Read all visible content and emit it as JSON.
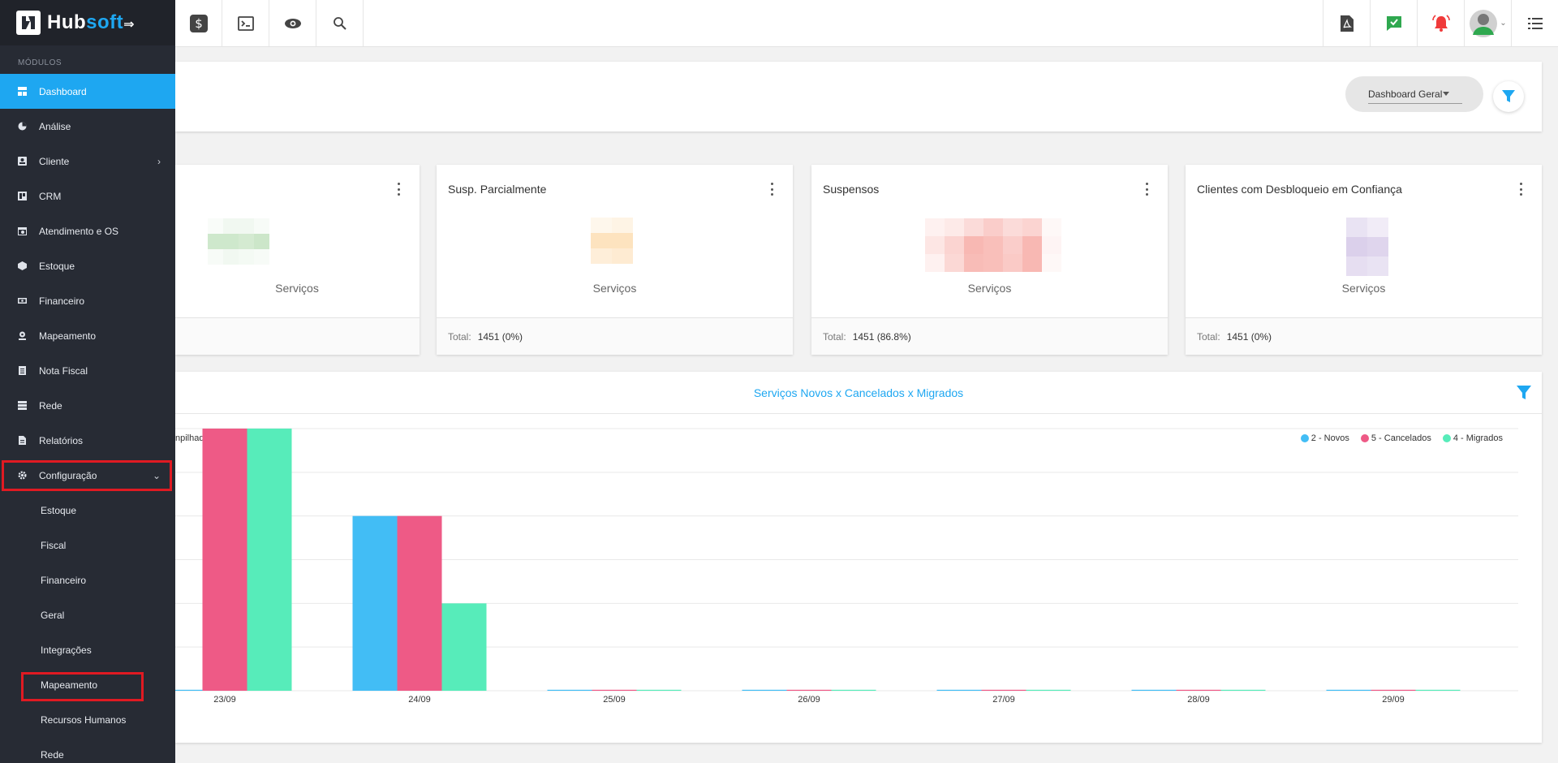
{
  "brand": {
    "part1": "Hub",
    "part2": "soft"
  },
  "sidebar": {
    "section_label": "MÓDULOS",
    "items": [
      {
        "label": "Dashboard",
        "icon": "dashboard-icon"
      },
      {
        "label": "Análise",
        "icon": "pie-chart-icon"
      },
      {
        "label": "Cliente",
        "icon": "contact-card-icon"
      },
      {
        "label": "CRM",
        "icon": "board-icon"
      },
      {
        "label": "Atendimento e OS",
        "icon": "calendar-icon"
      },
      {
        "label": "Estoque",
        "icon": "box-icon"
      },
      {
        "label": "Financeiro",
        "icon": "money-icon"
      },
      {
        "label": "Mapeamento",
        "icon": "map-pin-icon"
      },
      {
        "label": "Nota Fiscal",
        "icon": "receipt-icon"
      },
      {
        "label": "Rede",
        "icon": "server-icon"
      },
      {
        "label": "Relatórios",
        "icon": "document-icon"
      },
      {
        "label": "Configuração",
        "icon": "gear-icon"
      }
    ],
    "sub_items": [
      {
        "label": "Estoque"
      },
      {
        "label": "Fiscal"
      },
      {
        "label": "Financeiro"
      },
      {
        "label": "Geral"
      },
      {
        "label": "Integrações"
      },
      {
        "label": "Mapeamento"
      },
      {
        "label": "Recursos Humanos"
      },
      {
        "label": "Rede"
      }
    ]
  },
  "toolbar": {
    "dashboard_select": "Dashboard Geral"
  },
  "stat_cards": [
    {
      "title": "",
      "sub": "Serviços",
      "total_label": "",
      "total_value": "",
      "color": "#c9e5c6"
    },
    {
      "title": "Susp. Parcialmente",
      "sub": "Serviços",
      "total_label": "Total:",
      "total_value": "1451 (0%)",
      "color": "#fde3bf"
    },
    {
      "title": "Suspensos",
      "sub": "Serviços",
      "total_label": "Total:",
      "total_value": "1451 (86.8%)",
      "color": "#f8b8b3"
    },
    {
      "title": "Clientes com Desbloqueio em Confiança",
      "sub": "Serviços",
      "total_label": "Total:",
      "total_value": "1451 (0%)",
      "color": "#dbd0eb"
    }
  ],
  "chart": {
    "title": "Serviços Novos x Cancelados x Migrados",
    "stacked_label": "npilhados"
  },
  "chart_data": {
    "type": "bar",
    "title": "Serviços Novos x Cancelados x Migrados",
    "categories": [
      "23/09",
      "24/09",
      "25/09",
      "26/09",
      "27/09",
      "28/09",
      "29/09"
    ],
    "series": [
      {
        "name": "2 - Novos",
        "color": "#42bdf5",
        "values": [
          0,
          2,
          0,
          0,
          0,
          0,
          0
        ]
      },
      {
        "name": "5 - Cancelados",
        "color": "#ee5a86",
        "values": [
          3,
          2,
          0,
          0,
          0,
          0,
          0
        ]
      },
      {
        "name": "4 - Migrados",
        "color": "#57ecba",
        "values": [
          3,
          1,
          0,
          0,
          0,
          0,
          0
        ]
      }
    ],
    "ylim": [
      0,
      3
    ],
    "grid": true,
    "legend": "top-right"
  }
}
